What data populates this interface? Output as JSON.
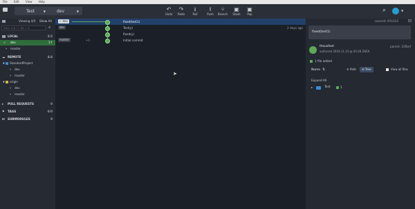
{
  "menubar": {
    "items": [
      "File",
      "Edit",
      "View",
      "Help"
    ]
  },
  "toolbar": {
    "repo": "Test",
    "branch": "dev",
    "buttons": [
      {
        "label": "Undo",
        "icon": "undo-icon",
        "glyph": "↶"
      },
      {
        "label": "Redo",
        "icon": "redo-icon",
        "glyph": "↷"
      },
      {
        "label": "Pull",
        "icon": "pull-icon",
        "glyph": "⭳"
      },
      {
        "label": "Push",
        "icon": "push-icon",
        "glyph": "⭱"
      },
      {
        "label": "Branch",
        "icon": "branch-icon",
        "glyph": "⑂"
      },
      {
        "label": "Stash",
        "icon": "stash-icon",
        "glyph": "▣"
      },
      {
        "label": "Pop",
        "icon": "pop-icon",
        "glyph": "▣"
      }
    ]
  },
  "left": {
    "viewing": "Viewing 4/5",
    "show_all": "Show All",
    "filter_placeholder": "Filter (Ctrl + Alt + f)",
    "local": {
      "label": "LOCAL",
      "count": "2/2",
      "items": [
        "dev",
        "master"
      ],
      "dev_badge": "1↑"
    },
    "remote": {
      "label": "REMOTE",
      "count": "4/4",
      "groups": [
        {
          "name": "StandardProject",
          "items": [
            "dev",
            "master"
          ]
        },
        {
          "name": "origin",
          "items": [
            "dev",
            "master"
          ]
        }
      ]
    },
    "pull_requests": {
      "label": "PULL REQUESTS",
      "count": "0"
    },
    "tags": {
      "label": "TAGS",
      "count": "0/0"
    },
    "submodules": {
      "label": "SUBMODULES",
      "count": "0"
    }
  },
  "graph": {
    "rows": [
      {
        "refs": [
          "dev"
        ],
        "msg": "fixed(test1)",
        "time": ""
      },
      {
        "refs": [
          "dev"
        ],
        "msg": "Test(y)",
        "time": "2 days ago"
      },
      {
        "refs": [],
        "msg": "fixed(y)",
        "time": ""
      },
      {
        "refs": [
          "master",
          "+1"
        ],
        "msg": "Initial commit",
        "time": ""
      }
    ]
  },
  "right": {
    "commit_label": "commit: 87e314",
    "message": "fixed(test1)",
    "author": "thousfeet",
    "parent": "parent: 15fbef",
    "authored": "authored 2019.11.14 @ 05:28 DSE9",
    "files_added": "1 file added",
    "name_label": "Name",
    "path_btn": "Path",
    "tree_btn": "Tree",
    "view_all": "View all files",
    "expand_all": "Expand All",
    "folder": "Test",
    "file_badge": "1",
    "accent": "#3a8ad8"
  }
}
